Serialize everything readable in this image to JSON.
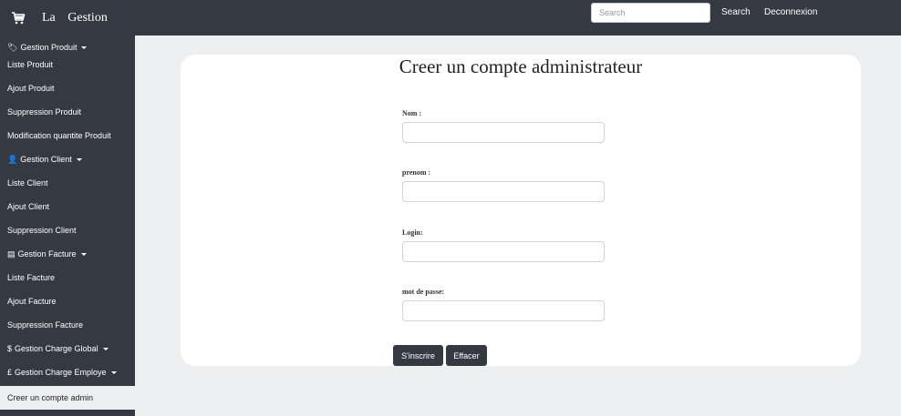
{
  "topbar": {
    "brand_icon": "shopping-cart-icon",
    "brand": "La Gestion",
    "search_placeholder": "Search",
    "search_link": "Search",
    "logout": "Deconnexion"
  },
  "sidebar": {
    "items": [
      {
        "label": "Gestion Produit",
        "icon": "tag-icon",
        "glyph": "🏷",
        "type": "header"
      },
      {
        "label": "Liste Produit",
        "type": "link"
      },
      {
        "label": "Ajout Produit",
        "type": "link"
      },
      {
        "label": "Suppression Produit",
        "type": "link"
      },
      {
        "label": "Modification quantite Produit",
        "type": "link"
      },
      {
        "label": "Gestion Client",
        "icon": "user-icon",
        "glyph": "👤",
        "type": "header"
      },
      {
        "label": "Liste Client",
        "type": "link"
      },
      {
        "label": "Ajout Client",
        "type": "link"
      },
      {
        "label": "Suppression Client",
        "type": "link"
      },
      {
        "label": "Gestion Facture",
        "icon": "list-icon",
        "glyph": "▤",
        "type": "header"
      },
      {
        "label": "Liste Facture",
        "type": "link"
      },
      {
        "label": "Ajout Facture",
        "type": "link"
      },
      {
        "label": "Suppression Facture",
        "type": "link"
      },
      {
        "label": "Gestion Charge Global",
        "icon": "dollar-icon",
        "glyph": "$",
        "type": "header"
      },
      {
        "label": "Gestion Charge Employe",
        "icon": "pound-icon",
        "glyph": "£",
        "type": "header"
      },
      {
        "label": "Creer un compte admin",
        "type": "link",
        "active": true
      }
    ]
  },
  "form": {
    "title": "Creer un compte administrateur",
    "fields": [
      {
        "label": "Nom :",
        "value": ""
      },
      {
        "label": "prenom :",
        "value": ""
      },
      {
        "label": "Login:",
        "value": ""
      },
      {
        "label": "mot de passe:",
        "value": ""
      }
    ],
    "submit": "S'inscrire",
    "reset": "Effacer"
  },
  "colors": {
    "dark": "#353a42",
    "background": "#eeeff1"
  }
}
